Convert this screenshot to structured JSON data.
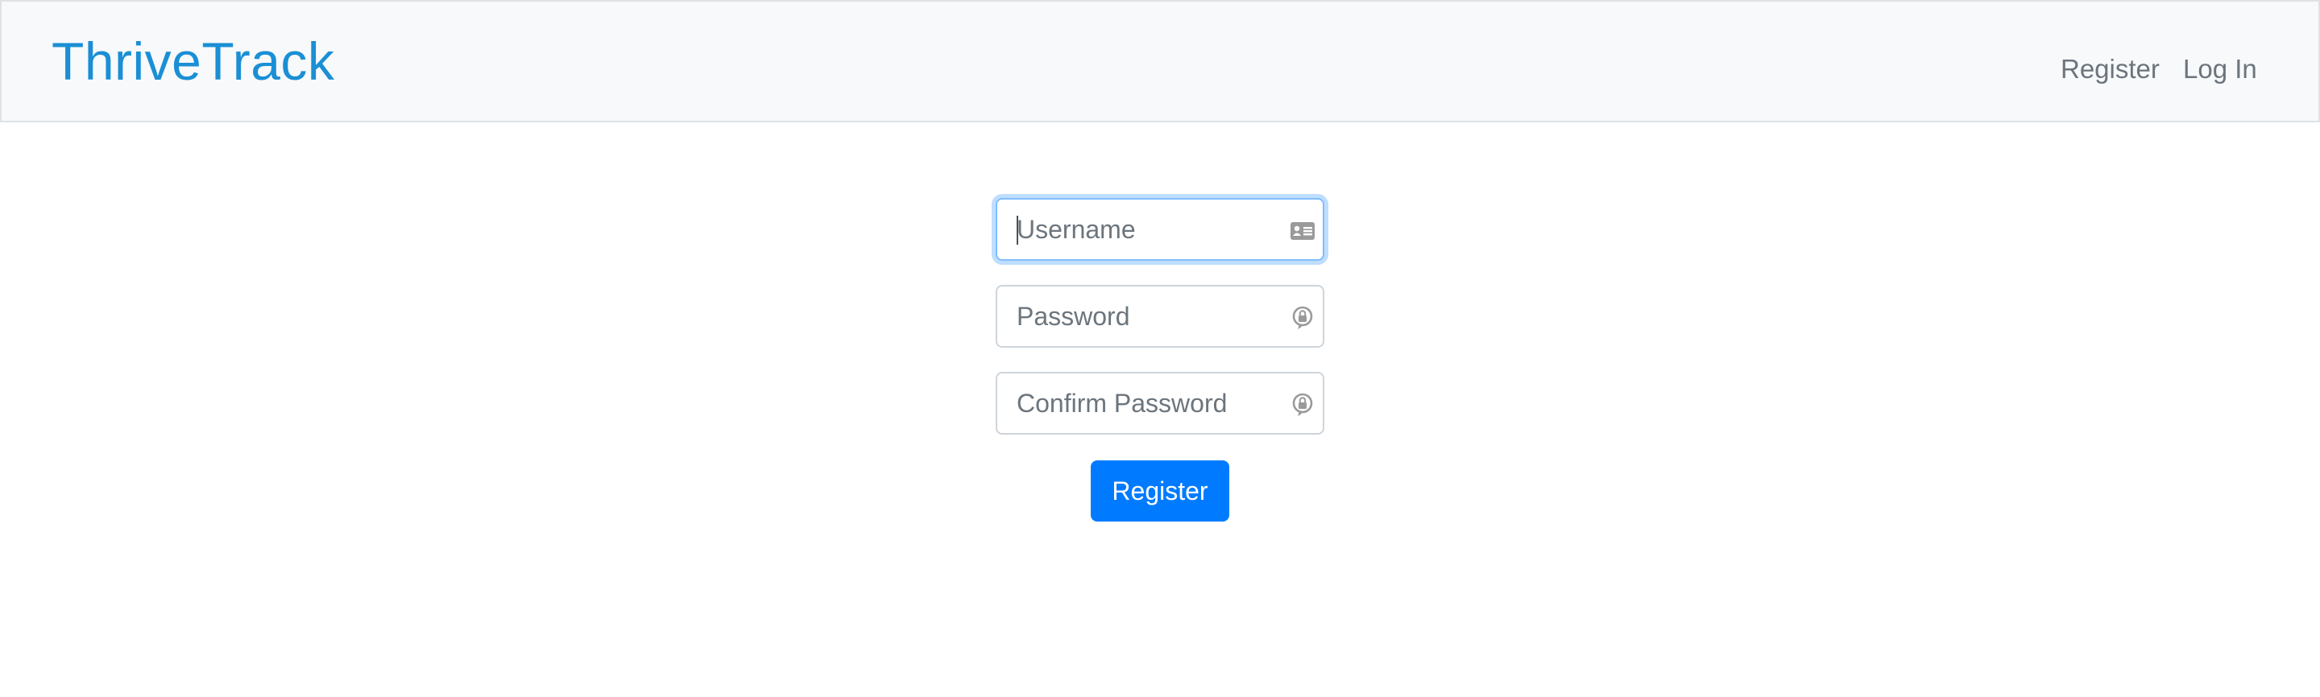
{
  "navbar": {
    "brand": "ThriveTrack",
    "links": [
      {
        "label": "Register"
      },
      {
        "label": "Log In"
      }
    ],
    "brand_color": "#1a8fd5",
    "background": "#f8f9fa"
  },
  "form": {
    "fields": [
      {
        "placeholder": "Username",
        "value": "",
        "icon": "contact-card-icon",
        "focused": true
      },
      {
        "placeholder": "Password",
        "value": "",
        "icon": "key-lock-icon"
      },
      {
        "placeholder": "Confirm Password",
        "value": "",
        "icon": "key-lock-icon"
      }
    ],
    "submit_label": "Register",
    "accent_color": "#007bff"
  }
}
